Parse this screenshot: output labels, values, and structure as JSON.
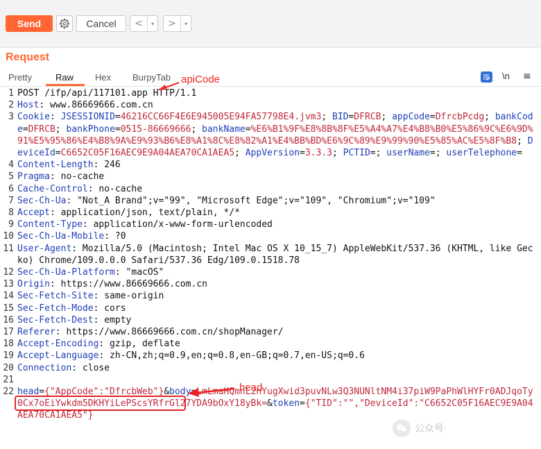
{
  "toolbar": {
    "send_label": "Send",
    "cancel_label": "Cancel",
    "back_glyph": "<",
    "forward_glyph": ">",
    "dropdown_glyph": "▾",
    "send_color": "#ff6633"
  },
  "request": {
    "title": "Request",
    "tabs": [
      "Pretty",
      "Raw",
      "Hex",
      "BurpyTab"
    ],
    "active_tab": "Raw",
    "newline_label": "\\n",
    "menu_glyph": "≡"
  },
  "annotations": {
    "apicode_label": "apiCode",
    "head_label": "head",
    "color": "#ee2222"
  },
  "code_lines": [
    [
      {
        "t": "POST /ifp/api/117101.app HTTP/1.1",
        "c": ""
      }
    ],
    [
      {
        "t": "Host",
        "c": "hk"
      },
      {
        "t": ": www.86669666.com.cn",
        "c": ""
      }
    ],
    [
      {
        "t": "Cookie",
        "c": "hk"
      },
      {
        "t": ": ",
        "c": ""
      },
      {
        "t": "JSESSIONID",
        "c": "bl"
      },
      {
        "t": "=",
        "c": ""
      },
      {
        "t": "46216CC66F4E6E945005E94FA57798E4.jvm3",
        "c": "rd"
      },
      {
        "t": "; ",
        "c": ""
      },
      {
        "t": "BID",
        "c": "bl"
      },
      {
        "t": "=",
        "c": ""
      },
      {
        "t": "DFRCB",
        "c": "rd"
      },
      {
        "t": "; ",
        "c": ""
      },
      {
        "t": "appCode",
        "c": "bl"
      },
      {
        "t": "=",
        "c": ""
      },
      {
        "t": "DfrcbPcdg",
        "c": "rd"
      },
      {
        "t": "; ",
        "c": ""
      },
      {
        "t": "bankCode",
        "c": "bl"
      },
      {
        "t": "=",
        "c": ""
      },
      {
        "t": "DFRCB",
        "c": "rd"
      },
      {
        "t": "; ",
        "c": ""
      },
      {
        "t": "bankPhone",
        "c": "bl"
      },
      {
        "t": "=",
        "c": ""
      },
      {
        "t": "0515-86669666",
        "c": "rd"
      },
      {
        "t": "; ",
        "c": ""
      },
      {
        "t": "bankName",
        "c": "bl"
      },
      {
        "t": "=",
        "c": ""
      },
      {
        "t": "%E6%B1%9F%E8%8B%8F%E5%A4%A7%E4%B8%B0%E5%86%9C%E6%9D%91%E5%95%86%E4%B8%9A%E9%93%B6%E8%A1%8C%E8%82%A1%E4%BB%BD%E6%9C%89%E9%99%90%E5%85%AC%E5%8F%B8",
        "c": "rd"
      },
      {
        "t": "; ",
        "c": ""
      },
      {
        "t": "DeviceId",
        "c": "bl"
      },
      {
        "t": "=",
        "c": ""
      },
      {
        "t": "C6652C05F16AEC9E9A04AEA70CA1AEA5",
        "c": "rd"
      },
      {
        "t": "; ",
        "c": ""
      },
      {
        "t": "AppVersion",
        "c": "bl"
      },
      {
        "t": "=",
        "c": ""
      },
      {
        "t": "3.3.3",
        "c": "rd"
      },
      {
        "t": "; ",
        "c": ""
      },
      {
        "t": "PCTID",
        "c": "bl"
      },
      {
        "t": "=; ",
        "c": ""
      },
      {
        "t": "userName",
        "c": "bl"
      },
      {
        "t": "=; ",
        "c": ""
      },
      {
        "t": "userTelephone",
        "c": "bl"
      },
      {
        "t": "=",
        "c": ""
      }
    ],
    [
      {
        "t": "Content-Length",
        "c": "hk"
      },
      {
        "t": ": 246",
        "c": ""
      }
    ],
    [
      {
        "t": "Pragma",
        "c": "hk"
      },
      {
        "t": ": no-cache",
        "c": ""
      }
    ],
    [
      {
        "t": "Cache-Control",
        "c": "hk"
      },
      {
        "t": ": no-cache",
        "c": ""
      }
    ],
    [
      {
        "t": "Sec-Ch-Ua",
        "c": "hk"
      },
      {
        "t": ": \"Not_A Brand\";v=\"99\", \"Microsoft Edge\";v=\"109\", \"Chromium\";v=\"109\"",
        "c": ""
      }
    ],
    [
      {
        "t": "Accept",
        "c": "hk"
      },
      {
        "t": ": application/json, text/plain, */*",
        "c": ""
      }
    ],
    [
      {
        "t": "Content-Type",
        "c": "hk"
      },
      {
        "t": ": application/x-www-form-urlencoded",
        "c": ""
      }
    ],
    [
      {
        "t": "Sec-Ch-Ua-Mobile",
        "c": "hk"
      },
      {
        "t": ": ?0",
        "c": ""
      }
    ],
    [
      {
        "t": "User-Agent",
        "c": "hk"
      },
      {
        "t": ": Mozilla/5.0 (Macintosh; Intel Mac OS X 10_15_7) AppleWebKit/537.36 (KHTML, like Gecko) Chrome/109.0.0.0 Safari/537.36 Edg/109.0.1518.78",
        "c": ""
      }
    ],
    [
      {
        "t": "Sec-Ch-Ua-Platform",
        "c": "hk"
      },
      {
        "t": ": \"macOS\"",
        "c": ""
      }
    ],
    [
      {
        "t": "Origin",
        "c": "hk"
      },
      {
        "t": ": https://www.86669666.com.cn",
        "c": ""
      }
    ],
    [
      {
        "t": "Sec-Fetch-Site",
        "c": "hk"
      },
      {
        "t": ": same-origin",
        "c": ""
      }
    ],
    [
      {
        "t": "Sec-Fetch-Mode",
        "c": "hk"
      },
      {
        "t": ": cors",
        "c": ""
      }
    ],
    [
      {
        "t": "Sec-Fetch-Dest",
        "c": "hk"
      },
      {
        "t": ": empty",
        "c": ""
      }
    ],
    [
      {
        "t": "Referer",
        "c": "hk"
      },
      {
        "t": ": https://www.86669666.com.cn/shopManager/",
        "c": ""
      }
    ],
    [
      {
        "t": "Accept-Encoding",
        "c": "hk"
      },
      {
        "t": ": gzip, deflate",
        "c": ""
      }
    ],
    [
      {
        "t": "Accept-Language",
        "c": "hk"
      },
      {
        "t": ": zh-CN,zh;q=0.9,en;q=0.8,en-GB;q=0.7,en-US;q=0.6",
        "c": ""
      }
    ],
    [
      {
        "t": "Connection",
        "c": "hk"
      },
      {
        "t": ": close",
        "c": ""
      }
    ],
    [
      {
        "t": "",
        "c": ""
      }
    ],
    [
      {
        "t": "head",
        "c": "bl"
      },
      {
        "t": "=",
        "c": ""
      },
      {
        "t": "{\"AppCode\":\"DfrcbWeb\"}",
        "c": "rd"
      },
      {
        "t": "&",
        "c": ""
      },
      {
        "t": "body",
        "c": "bl"
      },
      {
        "t": "=",
        "c": ""
      },
      {
        "t": "LmLmaHQmnL2nYugXwid3puvNLw3Q3NUNltNM4i37piW9PaPhWlHYFr0ADJqoTy0Cx7oEiYwkdm5DKHYiLePScsYRfrGl27YDA9bOxY18yBk=",
        "c": "rd"
      },
      {
        "t": "&",
        "c": ""
      },
      {
        "t": "token",
        "c": "bl"
      },
      {
        "t": "=",
        "c": ""
      },
      {
        "t": "{\"TID\":\"\",\"DeviceId\":\"C6652C05F16AEC9E9A04AEA70CA1AEA5\"}",
        "c": "rd"
      }
    ]
  ],
  "watermark": {
    "text": "公众号·"
  }
}
